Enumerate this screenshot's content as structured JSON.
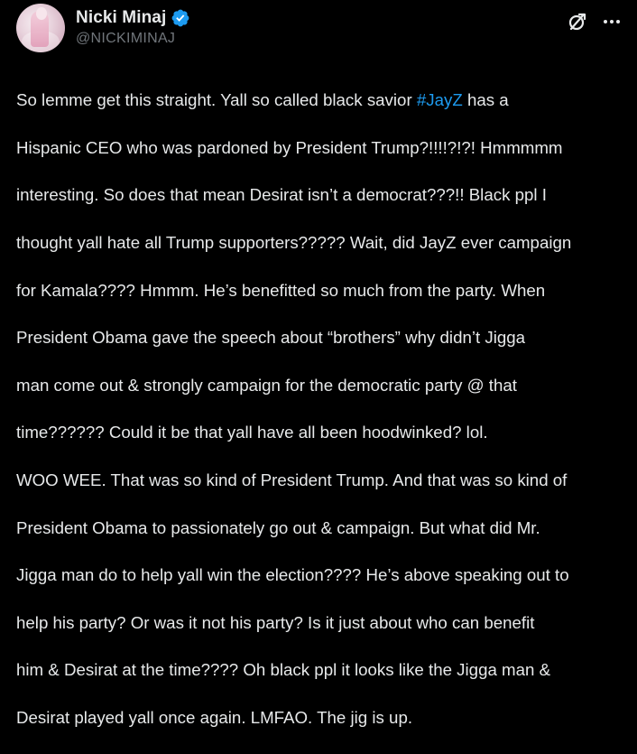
{
  "author": {
    "display_name": "Nicki Minaj",
    "handle": "@NICKIMINAJ",
    "verified": true
  },
  "icons": {
    "verified": "verified-badge-icon",
    "grok": "grok-icon",
    "more": "more-options-icon"
  },
  "colors": {
    "background": "#000000",
    "text": "#e7e9ea",
    "secondary_text": "#71767b",
    "link": "#1d9bf0"
  },
  "post": {
    "lines": [
      {
        "before": "So lemme get this straight. Yall so called black savior ",
        "hashtag": "#JayZ",
        "after": " has a"
      },
      {
        "text": "Hispanic CEO who was pardoned by President Trump?!!!!?!?! Hmmmmm"
      },
      {
        "text": "interesting. So does that mean Desirat isn’t a democrat???!! Black ppl I"
      },
      {
        "text": "thought yall hate all Trump supporters????? Wait, did JayZ ever campaign"
      },
      {
        "text": "for Kamala???? Hmmm. He’s benefitted so much from the party. When"
      },
      {
        "text": "President Obama gave the speech about “brothers” why didn’t Jigga"
      },
      {
        "text": "man come out & strongly campaign for the democratic party @ that"
      },
      {
        "text": "time?????? Could it be that yall have all been hoodwinked? lol."
      },
      {
        "text": "WOO WEE. That was so kind of President Trump. And that was so kind of"
      },
      {
        "text": "President Obama to passionately go out & campaign. But what did Mr."
      },
      {
        "text": "Jigga man do to help yall win the election???? He’s above speaking out to"
      },
      {
        "text": "help his party? Or was it not his party? Is it just about who can benefit"
      },
      {
        "text": "him & Desirat at the time???? Oh black ppl it looks like the Jigga man &"
      },
      {
        "text": "Desirat played yall once again. LMFAO. The jig is up."
      }
    ]
  }
}
